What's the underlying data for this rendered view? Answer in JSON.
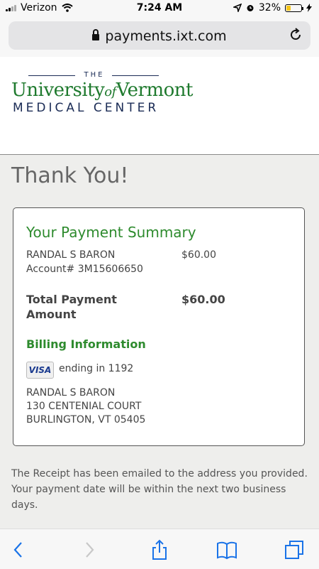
{
  "status": {
    "carrier": "Verizon",
    "time": "7:24 AM",
    "battery": "32%",
    "battery_level": 0.32
  },
  "browser": {
    "url": "payments.ixt.com"
  },
  "brand": {
    "the": "THE",
    "name_a": "University",
    "name_of": "of",
    "name_b": "Vermont",
    "subtitle": "MEDICAL CENTER"
  },
  "page": {
    "heading": "Thank You!"
  },
  "summary": {
    "title": "Your Payment Summary",
    "payer": "RANDAL S BARON",
    "account": "Account# 3M15606650",
    "amount": "$60.00",
    "total_label_1": "Total Payment",
    "total_label_2": "Amount",
    "total_amount": "$60.00"
  },
  "billing": {
    "title": "Billing Information",
    "card_brand": "VISA",
    "ending": "ending in 1192",
    "address": [
      "RANDAL S BARON",
      "130 CENTENIAL COURT",
      "BURLINGTON, VT 05405"
    ]
  },
  "receipt": {
    "text": "The Receipt has been emailed to the address you provided. Your payment date will be within the next two business days."
  },
  "colors": {
    "accent_green": "#2e8b2e",
    "ios_blue": "#1a73e8",
    "navy": "#1a2b55"
  }
}
